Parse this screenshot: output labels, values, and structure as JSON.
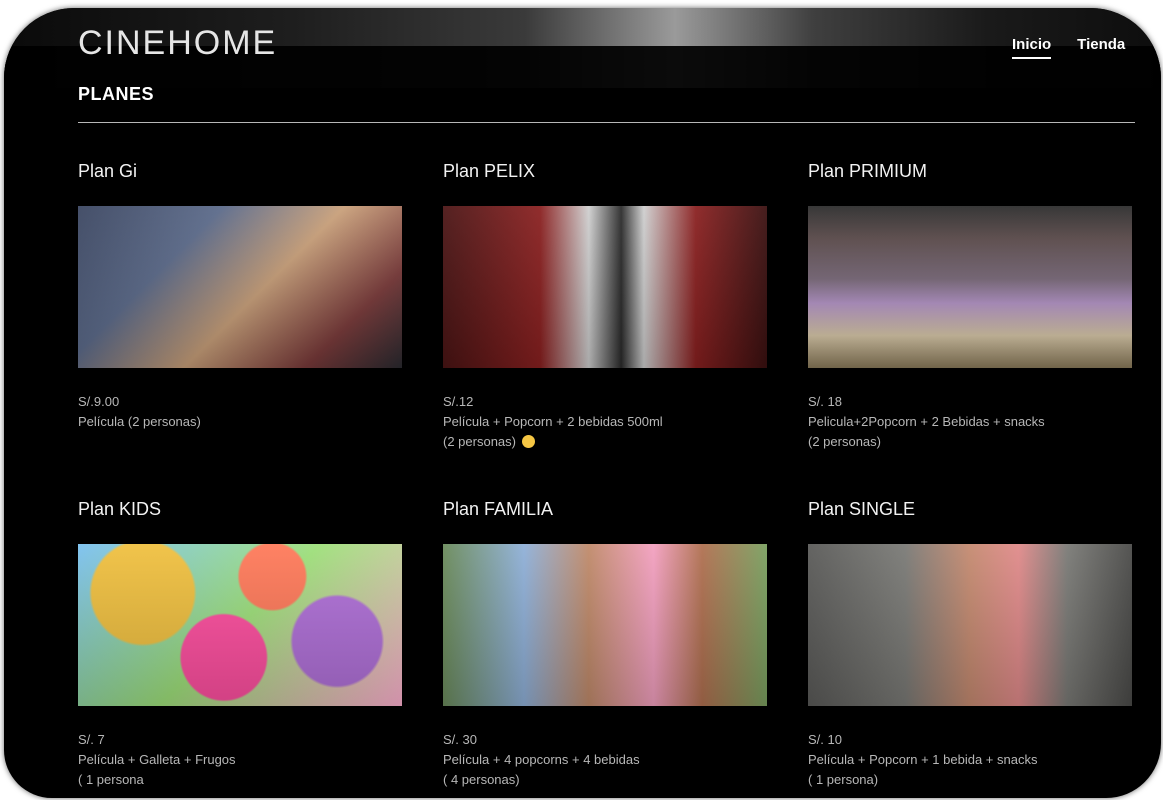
{
  "header": {
    "logo": "CINEHOME",
    "nav": [
      {
        "label": "Inicio",
        "active": true
      },
      {
        "label": "Tienda",
        "active": false
      }
    ]
  },
  "section": {
    "title": "PLANES"
  },
  "plans": [
    {
      "name": "Plan Gi",
      "price": "S/.9.00",
      "desc": [
        "Película (2 personas)"
      ],
      "image": "couple-3d-glasses-popcorn"
    },
    {
      "name": "Plan PELIX",
      "price": "S/.12",
      "desc": [
        "Película + Popcorn + 2 bebidas 500ml",
        "(2 personas)"
      ],
      "emoji": "smiling-face-icon",
      "image": "woman-holding-popcorn-cinema-seat"
    },
    {
      "name": "Plan PRIMIUM",
      "price": "S/. 18",
      "desc": [
        "Pelicula+2Popcorn + 2 Bebidas + snacks",
        "(2 personas)"
      ],
      "image": "home-theater-room"
    },
    {
      "name": "Plan KIDS",
      "price": "S/. 7",
      "desc": [
        "Película + Galleta + Frugos",
        "( 1 persona"
      ],
      "image": "girl-pink-dress-balloons"
    },
    {
      "name": "Plan FAMILIA",
      "price": "S/. 30",
      "desc": [
        "Película + 4 popcorns + 4 bebidas",
        "( 4 personas)"
      ],
      "image": "family-hugging-outdoors"
    },
    {
      "name": "Plan SINGLE",
      "price": "S/. 10",
      "desc": [
        "Película + Popcorn + 1 bebida + snacks",
        "( 1 persona)"
      ],
      "image": "smiling-man-glasses-cap"
    }
  ]
}
